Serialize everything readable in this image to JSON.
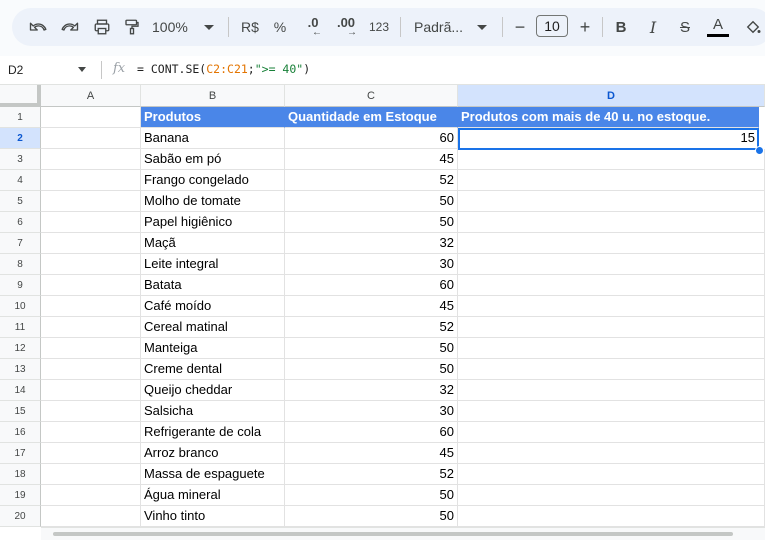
{
  "toolbar": {
    "zoom": "100%",
    "currency": "R$",
    "percent": "%",
    "decimal_decrease": ".0",
    "decimal_increase": ".00",
    "number_format": "123",
    "font_name": "Padrã...",
    "font_size": "10",
    "bold": "B",
    "italic": "I",
    "strike": "S",
    "text_color": "A"
  },
  "formula_bar": {
    "cell_ref": "D2",
    "formula_prefix": "= CONT.SE(",
    "formula_range": "C2:C21",
    "formula_sep": ";",
    "formula_criteria": "\">= 40\"",
    "formula_suffix": ")"
  },
  "columns": [
    "A",
    "B",
    "C",
    "D"
  ],
  "rows": [
    "1",
    "2",
    "3",
    "4",
    "5",
    "6",
    "7",
    "8",
    "9",
    "10",
    "11",
    "12",
    "13",
    "14",
    "15",
    "16",
    "17",
    "18",
    "19",
    "20"
  ],
  "sheet": {
    "header": {
      "products": "Produtos",
      "stock": "Quantidade em Estoque",
      "result": "Produtos com mais de 40 u. no estoque."
    },
    "result_value": "15",
    "products": [
      "Banana",
      "Sabão em pó",
      "Frango congelado",
      "Molho de tomate",
      "Papel higiênico",
      "Maçã",
      "Leite integral",
      "Batata",
      "Café moído",
      "Cereal matinal",
      "Manteiga",
      "Creme dental",
      "Queijo cheddar",
      "Salsicha",
      "Refrigerante de cola",
      "Arroz branco",
      "Massa de espaguete",
      "Água mineral",
      "Vinho tinto"
    ],
    "stock": [
      "60",
      "45",
      "52",
      "50",
      "50",
      "32",
      "30",
      "60",
      "45",
      "52",
      "50",
      "50",
      "32",
      "30",
      "60",
      "45",
      "52",
      "50",
      "50"
    ]
  },
  "colors": {
    "header_fill": "#4a86e8",
    "selection": "#1a73e8"
  }
}
